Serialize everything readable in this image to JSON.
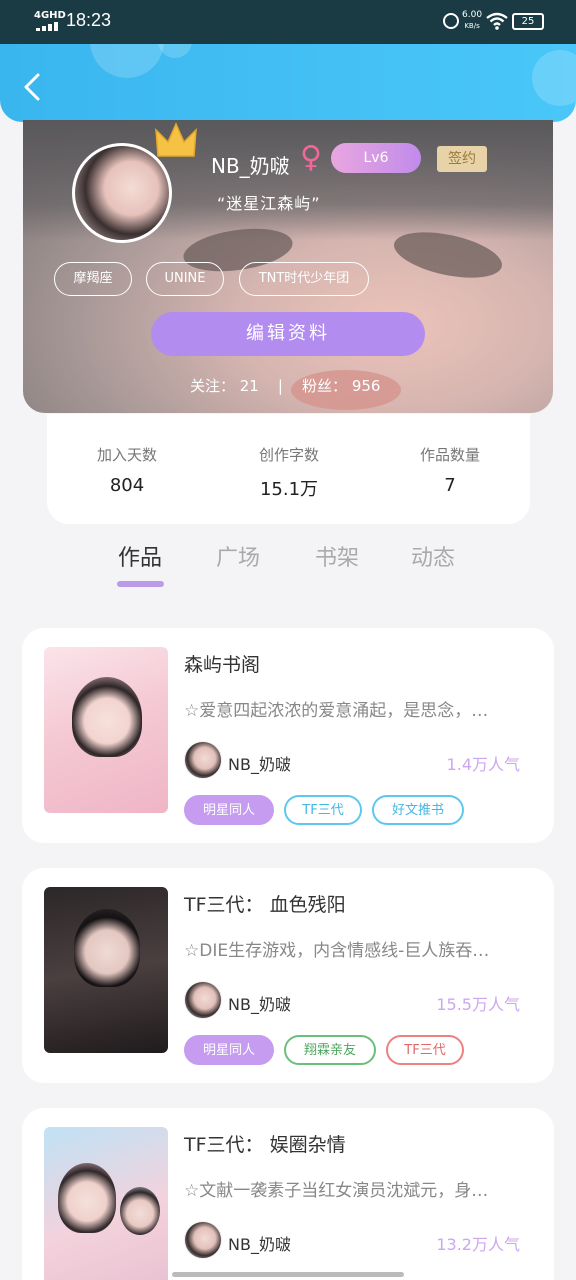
{
  "status_bar": {
    "network": "4GHD",
    "time": "18:23",
    "speed_value": "6.00",
    "speed_unit": "KB/s",
    "battery": "25"
  },
  "header": {
    "back_icon": "chevron-left-icon"
  },
  "profile": {
    "nickname": "NB_奶啵",
    "gender_symbol": "♀",
    "level": "Lv6",
    "sign_badge": "签约",
    "motto": "“迷星江森屿”",
    "tags": [
      "摩羯座",
      "UNINE",
      "TNT时代少年团"
    ],
    "edit_button": "编辑资料",
    "follow_line": "关注： 21    |    粉丝： 956"
  },
  "stats": [
    {
      "label": "加入天数",
      "value": "804"
    },
    {
      "label": "创作字数",
      "value": "15.1万"
    },
    {
      "label": "作品数量",
      "value": "7"
    }
  ],
  "tabs": [
    "作品",
    "广场",
    "书架",
    "动态"
  ],
  "active_tab": "作品",
  "works": [
    {
      "title": "森屿书阁",
      "desc": "☆爱意四起浓浓的爱意涌起，是思念，…",
      "author": "NB_奶啵",
      "popularity": "1.4万人气",
      "tags": [
        {
          "text": "明星同人",
          "style": "purple"
        },
        {
          "text": "TF三代",
          "style": "blue"
        },
        {
          "text": "好文推书",
          "style": "blue"
        }
      ]
    },
    {
      "title": "TF三代： 血色残阳",
      "desc": "☆DIE生存游戏，内含情感线-巨人族吞…",
      "author": "NB_奶啵",
      "popularity": "15.5万人气",
      "tags": [
        {
          "text": "明星同人",
          "style": "purple"
        },
        {
          "text": "翔霖亲友",
          "style": "green"
        },
        {
          "text": "TF三代",
          "style": "red"
        }
      ]
    },
    {
      "title": "TF三代： 娱圈杂情",
      "desc": "☆文献一袭素子当红女演员沈斌元，身…",
      "author": "NB_奶啵",
      "popularity": "13.2万人气",
      "tags": []
    }
  ],
  "colors": {
    "header_blue": "#3ab6ef",
    "accent_purple": "#b38cf0",
    "popularity_purple": "#cca7f0"
  }
}
